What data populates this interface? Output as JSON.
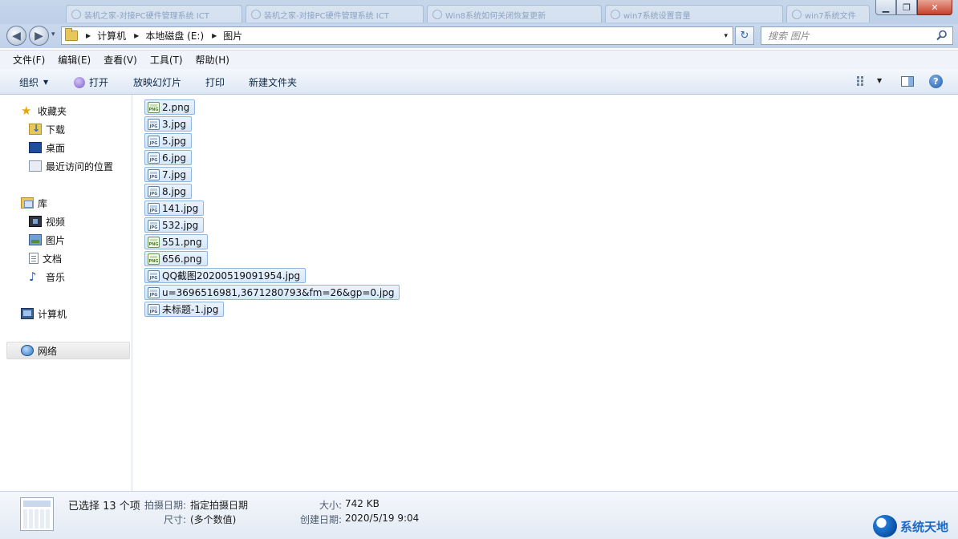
{
  "titlebar": {
    "ghost_tabs": [
      "装机之家-对接PC硬件管理系统 ICT",
      "装机之家-对接PC硬件管理系统 ICT",
      "Win8系统如何关闭恢复更新",
      "win7系统设置音量",
      "win7系统文件"
    ],
    "minimize": "▁",
    "maximize": "❐",
    "close": "✕"
  },
  "nav": {
    "back": "◀",
    "forward": "▶",
    "dropdown": "▾",
    "breadcrumb": [
      "计算机",
      "本地磁盘 (E:)",
      "图片"
    ],
    "separator": "▶",
    "address_dropdown": "▾",
    "refresh": "↻",
    "search_placeholder": "搜索 图片"
  },
  "menu": [
    "文件(F)",
    "编辑(E)",
    "查看(V)",
    "工具(T)",
    "帮助(H)"
  ],
  "toolbar": {
    "organize": "组织",
    "open": "打开",
    "slideshow": "放映幻灯片",
    "print": "打印",
    "new_folder": "新建文件夹",
    "help": "?"
  },
  "sidebar": {
    "favorites": "收藏夹",
    "downloads": "下载",
    "desktop": "桌面",
    "recent": "最近访问的位置",
    "libraries": "库",
    "videos": "视频",
    "pictures": "图片",
    "documents": "文档",
    "music": "音乐",
    "computer": "计算机",
    "network": "网络"
  },
  "files": [
    {
      "name": "2.png",
      "type": "PNG"
    },
    {
      "name": "3.jpg",
      "type": "JPG"
    },
    {
      "name": "5.jpg",
      "type": "JPG"
    },
    {
      "name": "6.jpg",
      "type": "JPG"
    },
    {
      "name": "7.jpg",
      "type": "JPG"
    },
    {
      "name": "8.jpg",
      "type": "JPG"
    },
    {
      "name": "141.jpg",
      "type": "JPG"
    },
    {
      "name": "532.jpg",
      "type": "JPG"
    },
    {
      "name": "551.png",
      "type": "PNG"
    },
    {
      "name": "656.png",
      "type": "PNG"
    },
    {
      "name": "QQ截图20200519091954.jpg",
      "type": "JPG"
    },
    {
      "name": "u=3696516981,3671280793&fm=26&gp=0.jpg",
      "type": "JPG"
    },
    {
      "name": "未标题-1.jpg",
      "type": "JPG"
    }
  ],
  "details": {
    "selected": "已选择 13 个项",
    "date_taken_label": "拍摄日期:",
    "date_taken_value": "指定拍摄日期",
    "dimensions_label": "尺寸:",
    "dimensions_value": "(多个数值)",
    "size_label": "大小:",
    "size_value": "742 KB",
    "created_label": "创建日期:",
    "created_value": "2020/5/19 9:04"
  },
  "watermark": "系统天地"
}
